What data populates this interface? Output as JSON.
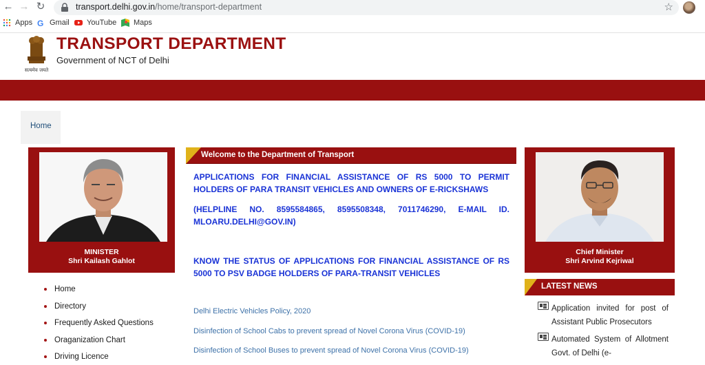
{
  "browser": {
    "url_host": "transport.delhi.gov.in",
    "url_path": "/home/transport-department",
    "bookmarks": [
      "Apps",
      "Gmail",
      "YouTube",
      "Maps"
    ]
  },
  "site": {
    "title": "TRANSPORT DEPARTMENT",
    "subtitle": "Government of NCT of Delhi",
    "emblem_motto": "सत्यमेव जयते"
  },
  "breadcrumb": "Home",
  "minister": {
    "role": "MINISTER",
    "name": "Shri Kailash Gahlot"
  },
  "chief_minister": {
    "role": "Chief Minister",
    "name": "Shri Arvind Kejriwal"
  },
  "welcome_heading": "Welcome to the Department of Transport",
  "notices": [
    "APPLICATIONS FOR FINANCIAL ASSISTANCE OF RS 5000 TO PERMIT HOLDERS OF PARA TRANSIT VEHICLES AND OWNERS OF E-RICKSHAWS",
    "(HELPLINE NO. 8595584865, 8595508348, 7011746290, E-MAIL ID. MLOARU.DELHI@GOV.IN)",
    "KNOW THE STATUS OF APPLICATIONS FOR FINANCIAL ASSISTANCE OF RS 5000 TO PSV BADGE HOLDERS OF PARA-TRANSIT VEHICLES"
  ],
  "links": [
    "Delhi Electric Vehicles Policy, 2020",
    "Disinfection of  School Cabs to prevent spread of Novel Corona Virus (COVID-19)",
    "Disinfection of School Buses to prevent spread of Novel Corona Virus (COVID-19)"
  ],
  "menu": [
    "Home",
    "Directory",
    "Frequently Asked Questions",
    "Oraganization Chart",
    "Driving Licence"
  ],
  "latest_news": {
    "heading": "LATEST NEWS",
    "items": [
      "Application invited for post of Assistant Public Prosecutors",
      "Automated System of Allotment Govt. of Delhi (e-"
    ]
  },
  "colors": {
    "brand_red": "#991010",
    "accent_yellow": "#e0b21a",
    "notice_blue": "#1a33d6"
  }
}
